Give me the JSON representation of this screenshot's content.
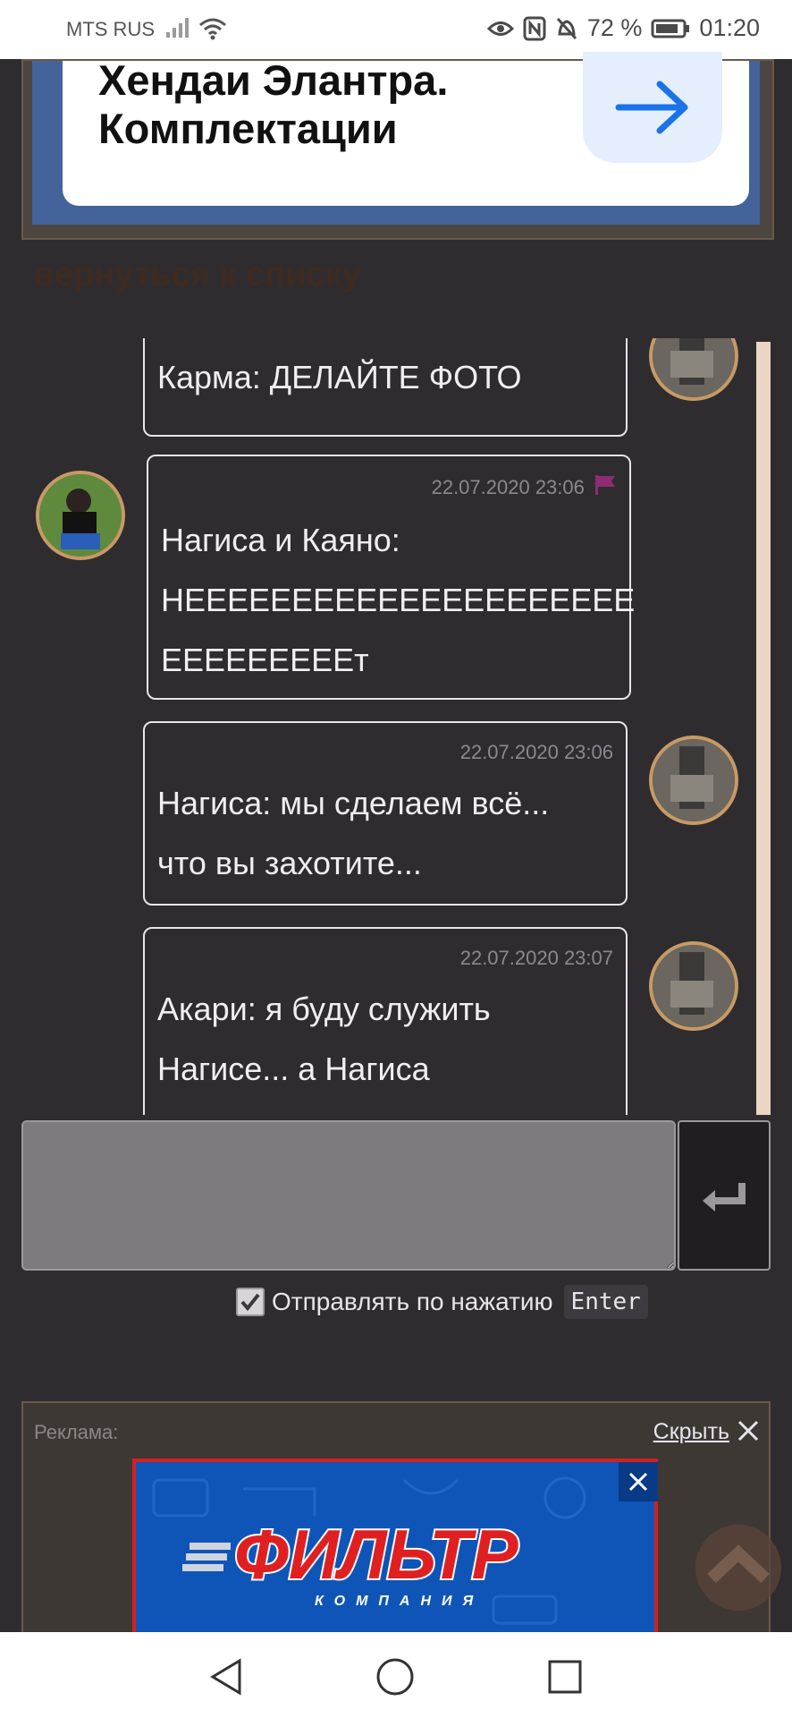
{
  "status": {
    "carrier": "MTS RUS",
    "battery": "72 %",
    "time": "01:20"
  },
  "top_ad": {
    "line1": "Хендаи Элантра.",
    "line2": "Комплектации"
  },
  "back_link": "вернуться к списку",
  "messages": [
    {
      "time": "",
      "lines": [
        "Карма: ДЕЛАЙТЕ ФОТО"
      ],
      "side": "right"
    },
    {
      "time": "22.07.2020 23:06",
      "lines": [
        "Нагиса и Каяно:",
        "НЕЕЕЕЕЕЕЕЕЕЕЕЕЕЕЕЕЕЕЕЕ",
        "ЕЕЕЕЕЕЕЕЕт"
      ],
      "side": "left",
      "flag": true
    },
    {
      "time": "22.07.2020 23:06",
      "lines": [
        "Нагиса: мы сделаем всё...",
        "что вы захотите..."
      ],
      "side": "right"
    },
    {
      "time": "22.07.2020 23:07",
      "lines": [
        "Акари: я буду служить",
        "Нагисе... а Нагиса"
      ],
      "side": "right"
    }
  ],
  "composer": {
    "placeholder": "",
    "send_on_enter_label": "Отправлять по нажатию",
    "send_on_enter_key": "Enter",
    "send_on_enter_checked": true
  },
  "bottom_ad": {
    "label": "Реклама:",
    "hide_label": "Скрыть",
    "banner_brand": "ФИЛЬТР",
    "banner_sub": "КОМПАНИЯ"
  },
  "colors": {
    "page_bg": "#2f2c30",
    "avatar_border": "#c79a65",
    "flag": "#8e2c72",
    "banner_bg": "#0f55b8",
    "banner_border": "#d42020"
  }
}
